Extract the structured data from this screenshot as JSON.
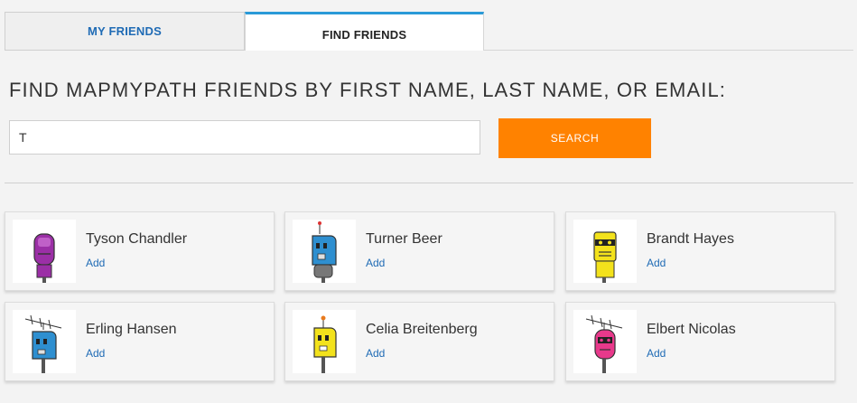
{
  "tabs": {
    "my_friends": "MY FRIENDS",
    "find_friends": "FIND FRIENDS"
  },
  "heading": "FIND MAPMYPATH FRIENDS BY FIRST NAME, LAST NAME, OR EMAIL:",
  "search": {
    "value": "T",
    "button_label": "SEARCH"
  },
  "results": [
    {
      "name": "Tyson Chandler",
      "add_label": "Add",
      "avatar_color": "#9b2fa6",
      "avatar": "robot-avatar-icon"
    },
    {
      "name": "Turner Beer",
      "add_label": "Add",
      "avatar_color": "#2e8fd0",
      "avatar": "robot-avatar-icon"
    },
    {
      "name": "Brandt Hayes",
      "add_label": "Add",
      "avatar_color": "#f3e21c",
      "avatar": "robot-avatar-icon"
    },
    {
      "name": "Erling Hansen",
      "add_label": "Add",
      "avatar_color": "#2e8fd0",
      "avatar": "robot-avatar-icon"
    },
    {
      "name": "Celia Breitenberg",
      "add_label": "Add",
      "avatar_color": "#f3e21c",
      "avatar": "robot-avatar-icon"
    },
    {
      "name": "Elbert Nicolas",
      "add_label": "Add",
      "avatar_color": "#e8398b",
      "avatar": "robot-avatar-icon"
    }
  ],
  "colors": {
    "accent_tab": "#2a9ad8",
    "search_button": "#ff8200",
    "link": "#1f6bb5"
  }
}
